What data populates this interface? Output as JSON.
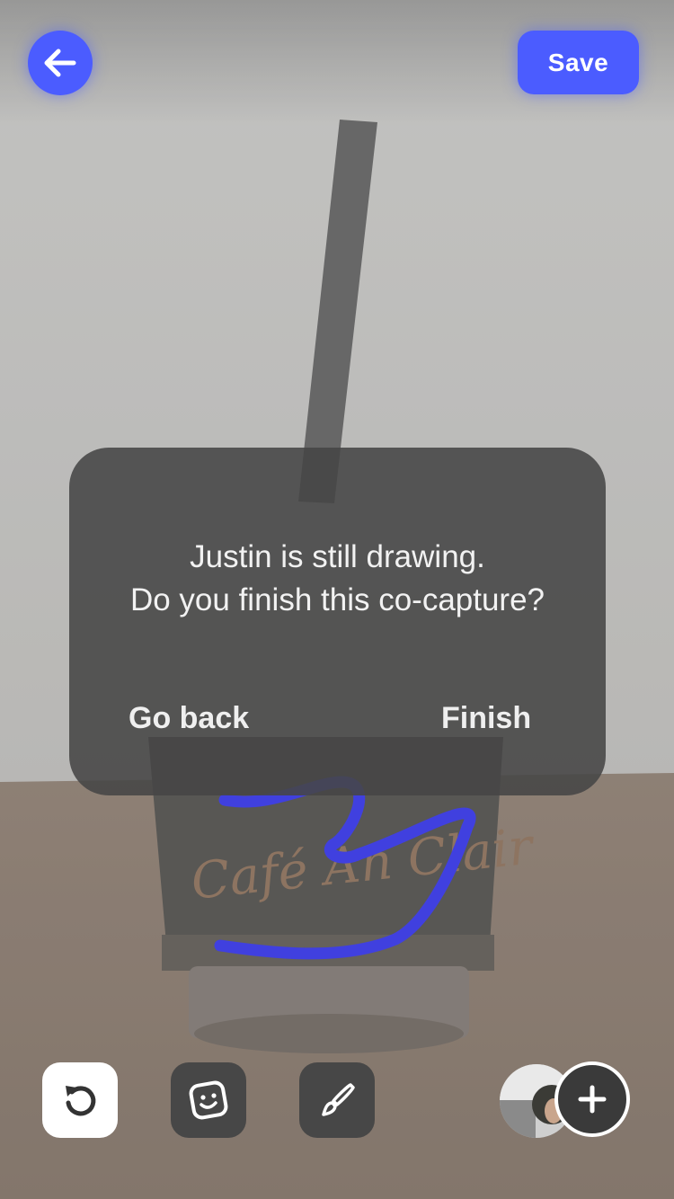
{
  "header": {
    "back_icon": "arrow-left-icon",
    "save_label": "Save"
  },
  "photo": {
    "cup_text": "Café An Clair"
  },
  "dialog": {
    "message": "Justin is still drawing.\nDo you finish this co-capture?",
    "go_back_label": "Go back",
    "finish_label": "Finish"
  },
  "toolbar": {
    "undo_icon": "undo-icon",
    "sticker_icon": "sticker-face-icon",
    "brush_icon": "brush-icon",
    "add_icon": "plus-icon"
  },
  "colors": {
    "accent": "#4b5cff",
    "drawing_stroke": "#3d3dff",
    "dialog_bg": "#464646"
  }
}
